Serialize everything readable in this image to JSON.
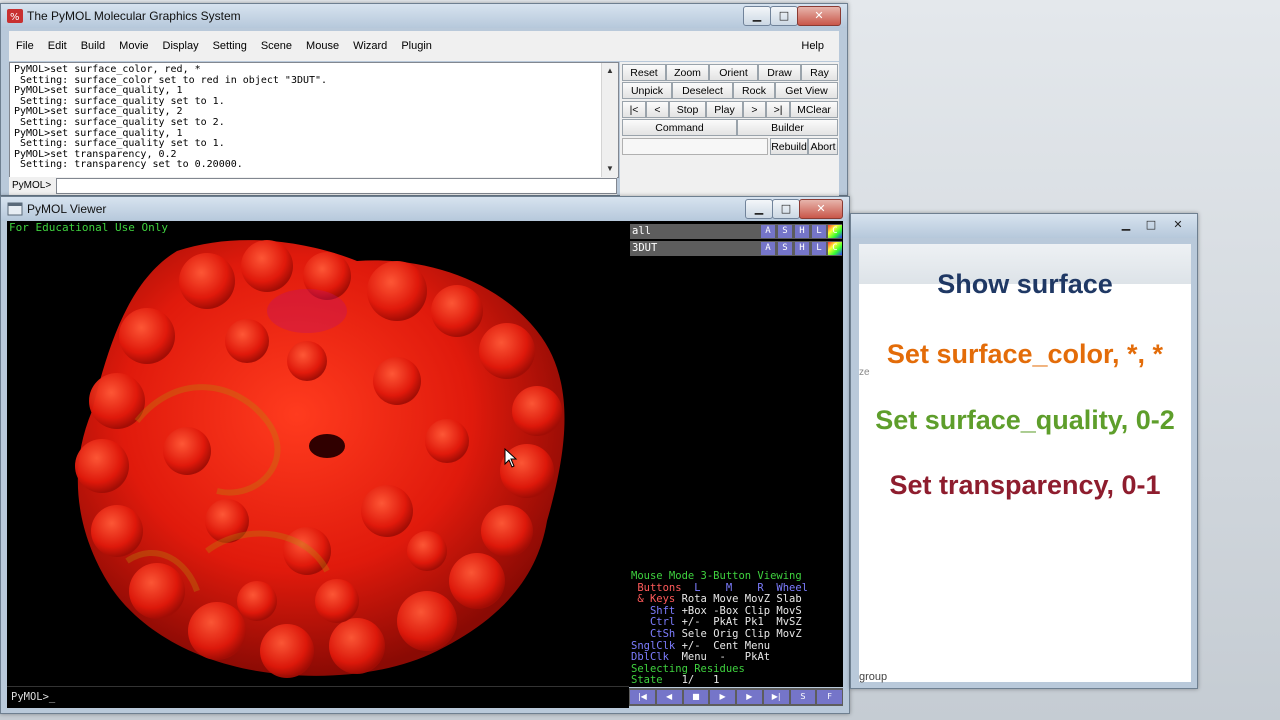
{
  "main_window": {
    "title": "The PyMOL Molecular Graphics System",
    "controls": {
      "minimize": "▁",
      "maximize": "□",
      "close": "✕"
    },
    "menu": [
      "File",
      "Edit",
      "Build",
      "Movie",
      "Display",
      "Setting",
      "Scene",
      "Mouse",
      "Wizard",
      "Plugin"
    ],
    "help": "Help",
    "log_text": "PyMOL>set surface_color, red, *\n Setting: surface_color set to red in object \"3DUT\".\nPyMOL>set surface_quality, 1\n Setting: surface_quality set to 1.\nPyMOL>set surface_quality, 2\n Setting: surface_quality set to 2.\nPyMOL>set surface_quality, 1\n Setting: surface_quality set to 1.\nPyMOL>set transparency, 0.2\n Setting: transparency set to 0.20000.",
    "command_label": "PyMOL>",
    "command_value": "",
    "buttons": {
      "reset": "Reset",
      "zoom": "Zoom",
      "orient": "Orient",
      "draw": "Draw",
      "ray": "Ray",
      "unpick": "Unpick",
      "deselect": "Deselect",
      "rock": "Rock",
      "get_view": "Get View",
      "first": "|<",
      "prev": "<",
      "stop": "Stop",
      "play": "Play",
      "next": ">",
      "last": ">|",
      "mclear": "MClear",
      "command": "Command",
      "builder": "Builder",
      "rebuild": "Rebuild",
      "abort": "Abort"
    }
  },
  "viewer_window": {
    "title": "PyMOL Viewer",
    "controls": {
      "minimize": "▁",
      "maximize": "□",
      "close": "✕"
    },
    "overlay": "For Educational Use Only",
    "command_prompt": "PyMOL>_",
    "objects": [
      {
        "name": "all",
        "buttons": [
          "A",
          "S",
          "H",
          "L",
          "C"
        ]
      },
      {
        "name": "3DUT",
        "buttons": [
          "A",
          "S",
          "H",
          "L",
          "C"
        ]
      }
    ],
    "mouse_mode": {
      "title": "Mouse Mode 3-Button Viewing",
      "header_buttons": " Buttons",
      "header_cols": "  L    M    R  Wheel",
      "rows": [
        {
          "label": " & Keys",
          "vals": " Rota Move MovZ Slab"
        },
        {
          "label": "   Shft",
          "vals": " +Box -Box Clip MovS"
        },
        {
          "label": "   Ctrl",
          "vals": " +/-  PkAt Pk1  MvSZ"
        },
        {
          "label": "   CtSh",
          "vals": " Sele Orig Clip MovZ"
        },
        {
          "label": "SnglClk",
          "vals": " +/-  Cent Menu"
        },
        {
          "label": "DblClk",
          "vals": "  Menu  -   PkAt"
        }
      ],
      "selecting": "Selecting Residues",
      "state_label": "State",
      "state_value": "   1/   1"
    },
    "playbar": [
      "|◀",
      "◀",
      "■",
      "▶",
      "▶",
      "▶|",
      "S",
      "F"
    ]
  },
  "slide_window": {
    "controls": {
      "minimize": "▁",
      "maximize": "□",
      "close": "✕"
    },
    "lines": [
      {
        "text": "Show surface",
        "color": "#1f3864"
      },
      {
        "text": "Set surface_color, *, *",
        "color": "#e36c09"
      },
      {
        "text": "Set surface_quality, 0-2",
        "color": "#5e9e2b"
      },
      {
        "text": "Set transparency, 0-1",
        "color": "#8e1d2e"
      }
    ],
    "side_text": "ze",
    "bottom_text": "group"
  }
}
